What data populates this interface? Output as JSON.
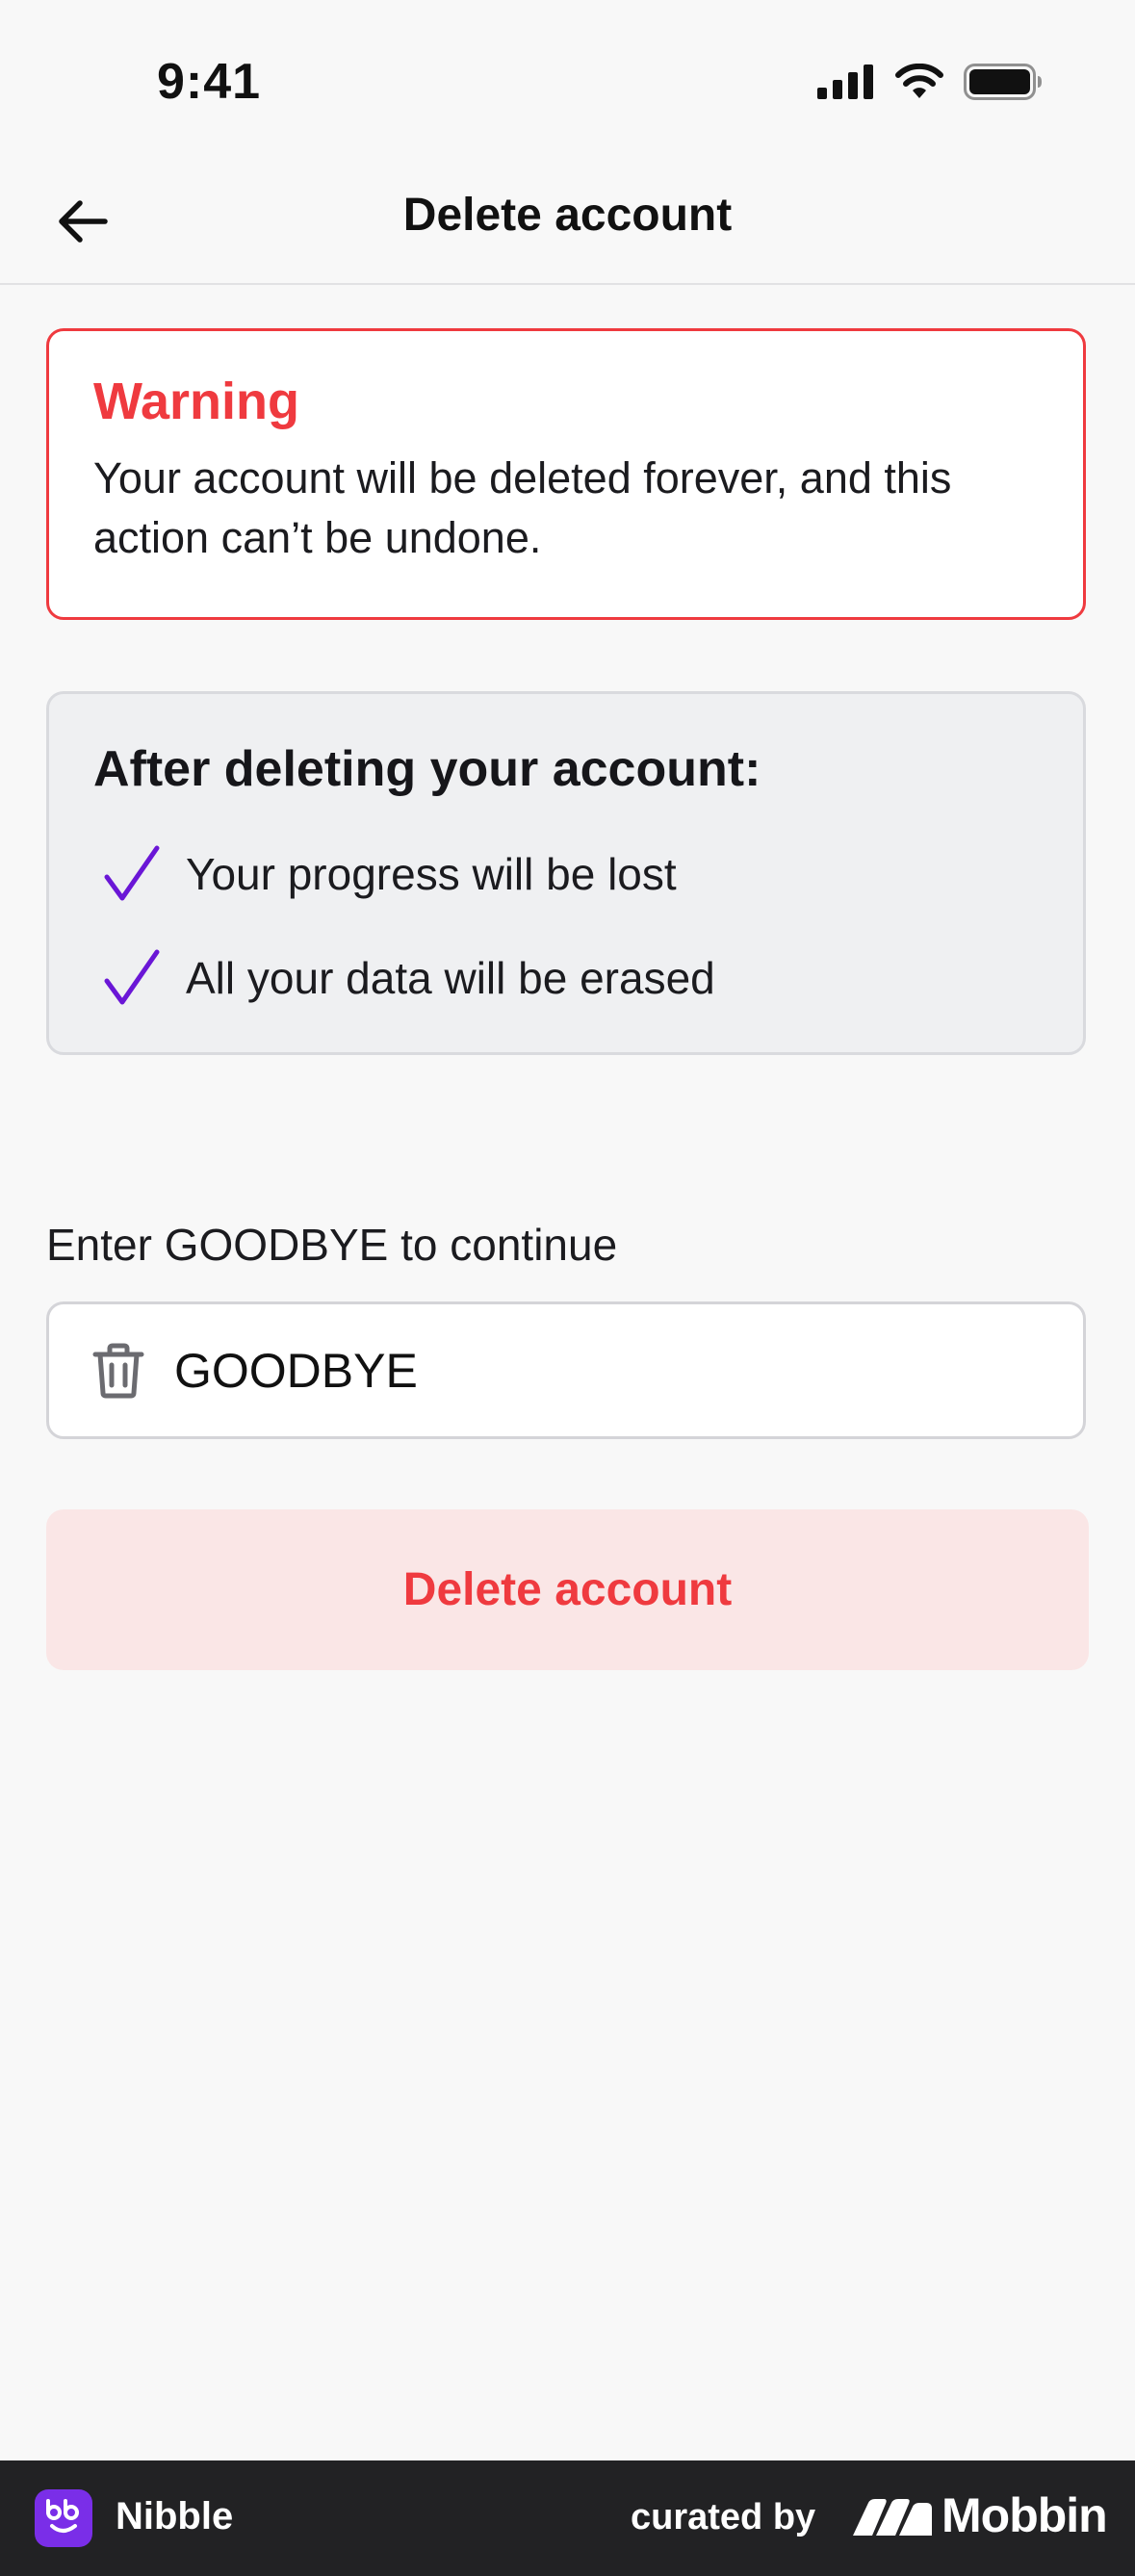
{
  "status_bar": {
    "time": "9:41",
    "icons": [
      "signal-icon",
      "wifi-icon",
      "battery-icon"
    ]
  },
  "nav": {
    "title": "Delete account",
    "back_icon": "arrow-left-icon"
  },
  "warning": {
    "title": "Warning",
    "text": "Your account will be deleted forever, and this action can’t be undone."
  },
  "info": {
    "title": "After deleting your account:",
    "items": [
      {
        "label": "Your progress will be lost"
      },
      {
        "label": "All your data will be erased"
      }
    ]
  },
  "confirm": {
    "prompt": "Enter GOODBYE to continue",
    "value": "GOODBYE",
    "icon": "trash-icon"
  },
  "delete_button": {
    "label": "Delete account"
  },
  "footer": {
    "app_name": "Nibble",
    "curated_by": "curated by",
    "brand": "Mobbin"
  },
  "colors": {
    "accent_red": "#ef3a3f",
    "check_purple": "#6a16d6",
    "button_bg": "#fae6e6",
    "footer_bg": "#222224"
  }
}
